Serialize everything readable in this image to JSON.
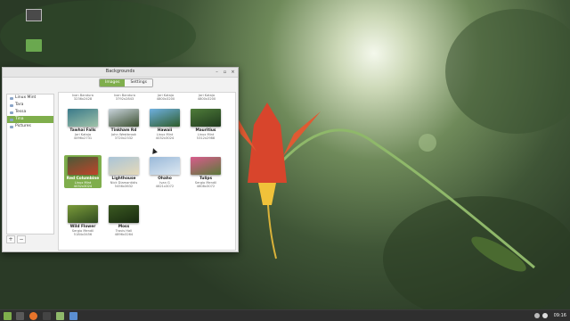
{
  "window": {
    "title": "Backgrounds",
    "tabs": [
      {
        "label": "Images",
        "active": true
      },
      {
        "label": "Settings",
        "active": false
      }
    ]
  },
  "sidebar": {
    "items": [
      {
        "label": "Linux Mint",
        "selected": false
      },
      {
        "label": "Tara",
        "selected": false
      },
      {
        "label": "Tessa",
        "selected": false
      },
      {
        "label": "Tina",
        "selected": true
      },
      {
        "label": "Pictures",
        "selected": false
      }
    ],
    "add_label": "+",
    "remove_label": "−"
  },
  "header_row": [
    {
      "author": "Ivan Bandura",
      "size": "3236x2428"
    },
    {
      "author": "Ivan Bandura",
      "size": "3792x2843"
    },
    {
      "author": "Jari Kataja",
      "size": "4800x3200"
    },
    {
      "author": "Jari Kataja",
      "size": "4800x3200"
    }
  ],
  "images": [
    {
      "name": "Tawhai Falls",
      "author": "Jari Kataja",
      "size": "4096x2731",
      "colors": [
        "#3a7a8a",
        "#9fc2a8"
      ],
      "selected": false
    },
    {
      "name": "Tinkham Rd",
      "author": "John Westbrook",
      "size": "3720x2332",
      "colors": [
        "#c9d4dc",
        "#3b4f2f"
      ],
      "selected": false
    },
    {
      "name": "Hawaii",
      "author": "Linux Mint",
      "size": "4032x3024",
      "colors": [
        "#6fb0e0",
        "#2d5c2a"
      ],
      "selected": false
    },
    {
      "name": "Mauritius",
      "author": "Linux Mint",
      "size": "5312x2988",
      "colors": [
        "#4f7c3a",
        "#1f3a1d"
      ],
      "selected": false
    },
    {
      "name": "Red Columbine",
      "author": "Linux Mint",
      "size": "4032x3024",
      "colors": [
        "#4a5a38",
        "#c0442a"
      ],
      "selected": true
    },
    {
      "name": "Lighthouse",
      "author": "Nick Diamantidis",
      "size": "5456x3632",
      "colors": [
        "#a9c4d8",
        "#e6d9b8"
      ],
      "selected": false
    },
    {
      "name": "Ohaho",
      "author": "Ivan G",
      "size": "4621x3072",
      "colors": [
        "#9ab9d9",
        "#dde8f1"
      ],
      "selected": false
    },
    {
      "name": "Tulips",
      "author": "Sergio Mendil",
      "size": "4608x3072",
      "colors": [
        "#d95b8c",
        "#5a7a3a"
      ],
      "selected": false
    },
    {
      "name": "Wild Flower",
      "author": "Sergio Mendil",
      "size": "5184x3456",
      "colors": [
        "#7a9a3a",
        "#2f4a1f"
      ],
      "selected": false
    },
    {
      "name": "Moss",
      "author": "Travis Hall",
      "size": "4896x3264",
      "colors": [
        "#3c5a22",
        "#182a10"
      ],
      "selected": false
    }
  ],
  "taskbar": {
    "clock": "09:16"
  }
}
